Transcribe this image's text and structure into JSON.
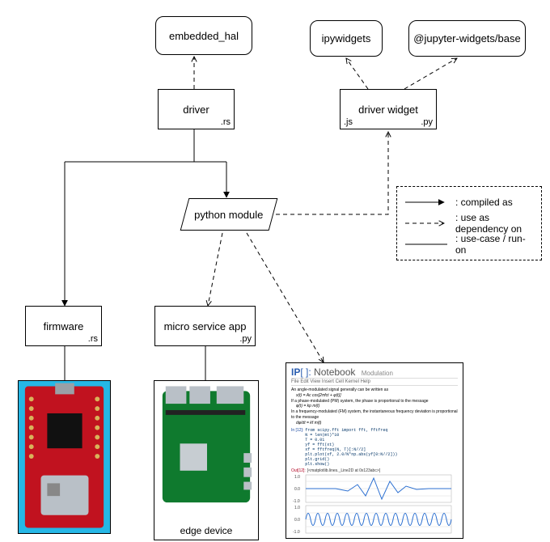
{
  "nodes": {
    "embedded_hal": "embedded_hal",
    "ipywidgets": "ipywidgets",
    "jupyter_base": "@jupyter-widgets/base",
    "driver": {
      "label": "driver",
      "ext": ".rs"
    },
    "driver_widget": {
      "label": "driver widget",
      "ext_left": ".js",
      "ext_right": ".py"
    },
    "python_module": "python module",
    "firmware": {
      "label": "firmware",
      "ext": ".rs"
    },
    "microservice": {
      "label": "micro service app",
      "ext": ".py"
    },
    "edge_device": "edge device"
  },
  "legend": {
    "compiled_as": ": compiled as",
    "dependency": ": use as dependency on",
    "usecase": ": use-case / run-on"
  },
  "notebook": {
    "title_a": "IP",
    "title_b": "[ ]:",
    "title_c": "Notebook",
    "subtitle": "Modulation",
    "line1": "An angle-modulated signal generally can be written as",
    "eq1": "x(t) = Ac cos[2πfct + φ(t)]",
    "line2": "If a phase-modulated (PM) system, the phase is proportional to the message",
    "eq2": "φ(t) = kp m(t)",
    "line3": "In a frequency-modulated (FM) system, the instantaneous frequency deviation is proportional to the message",
    "eq3": "dφ/dt = kf m(t)",
    "cell_label": "In [12]:",
    "code": [
      "from scipy.fft import fft, fftfreq",
      "N = len(mt)*10",
      "T = 0.01",
      "yf = fft(xt)",
      "xf = fftfreq(N, T)[:N//2]",
      "plt.plot(xf, 2.0/N*np.abs(yf[0:N//2]))",
      "plt.grid()",
      "plt.show()"
    ],
    "out_label": "Out[12]:",
    "out_text": "[<matplotlib.lines._Line2D at 0x123abc>]"
  }
}
